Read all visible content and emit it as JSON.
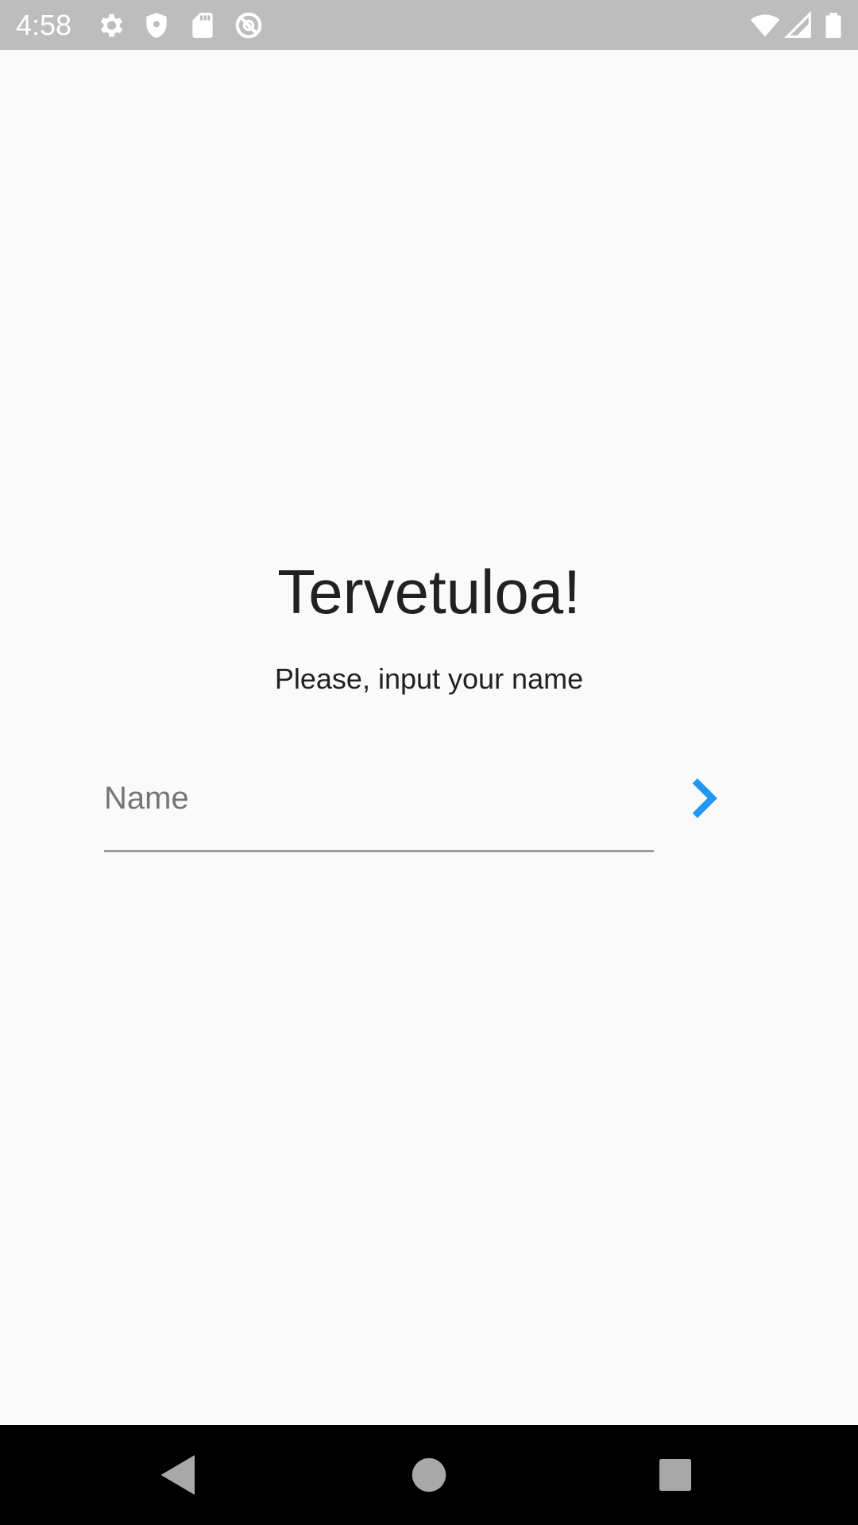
{
  "status_bar": {
    "time": "4:58",
    "background": "#bdbdbd",
    "left_icons": [
      "settings-icon",
      "shield-icon",
      "sd-card-icon",
      "do-not-disturb-icon"
    ],
    "right_icons": [
      "wifi-icon",
      "cell-signal-icon",
      "battery-icon"
    ]
  },
  "main": {
    "title": "Tervetuloa!",
    "subtitle": "Please, input your name",
    "name_field": {
      "placeholder": "Name",
      "value": ""
    },
    "next_button": {
      "icon": "chevron-right-icon",
      "color": "#2196f3"
    }
  },
  "nav_bar": {
    "buttons": [
      "back-icon",
      "home-icon",
      "recents-icon"
    ]
  }
}
